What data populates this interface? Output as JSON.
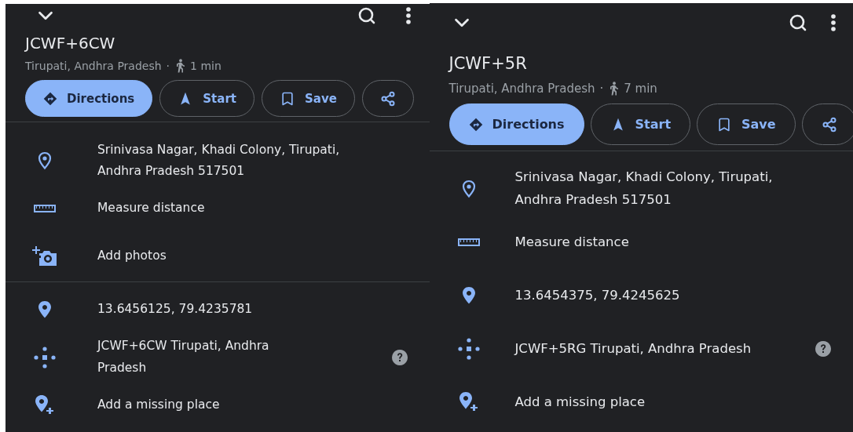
{
  "panels": [
    {
      "title": "JCWF+6CW",
      "subtitle": {
        "location": "Tirupati, Andhra Pradesh",
        "separator": "·",
        "walk_time": "1 min"
      },
      "actions": [
        {
          "kind": "directions",
          "label": "Directions"
        },
        {
          "kind": "start",
          "label": "Start"
        },
        {
          "kind": "save",
          "label": "Save"
        },
        {
          "kind": "share"
        }
      ],
      "sections": [
        [
          {
            "kind": "address",
            "text": "Srinivasa Nagar, Khadi Colony, Tirupati, Andhra Pradesh 517501"
          },
          {
            "kind": "measure",
            "text": "Measure distance"
          },
          {
            "kind": "photos",
            "text": "Add photos"
          }
        ],
        [
          {
            "kind": "coords",
            "text": "13.6456125, 79.4235781"
          },
          {
            "kind": "plus_code",
            "text": "JCWF+6CW Tirupati, Andhra Pradesh",
            "help": true
          },
          {
            "kind": "add_place",
            "text": "Add a missing place"
          }
        ]
      ]
    },
    {
      "title": "JCWF+5R",
      "subtitle": {
        "location": "Tirupati, Andhra Pradesh",
        "separator": "·",
        "walk_time": "7 min"
      },
      "actions": [
        {
          "kind": "directions",
          "label": "Directions"
        },
        {
          "kind": "start",
          "label": "Start"
        },
        {
          "kind": "save",
          "label": "Save"
        },
        {
          "kind": "share"
        }
      ],
      "sections": [
        [
          {
            "kind": "address",
            "text": "Srinivasa Nagar, Khadi Colony, Tirupati, Andhra Pradesh 517501"
          },
          {
            "kind": "measure",
            "text": "Measure distance"
          },
          {
            "kind": "coords",
            "text": "13.6454375, 79.4245625"
          },
          {
            "kind": "plus_code",
            "text": "JCWF+5RG Tirupati, Andhra Pradesh",
            "help": true
          },
          {
            "kind": "add_place",
            "text": "Add a missing place"
          }
        ]
      ]
    }
  ]
}
